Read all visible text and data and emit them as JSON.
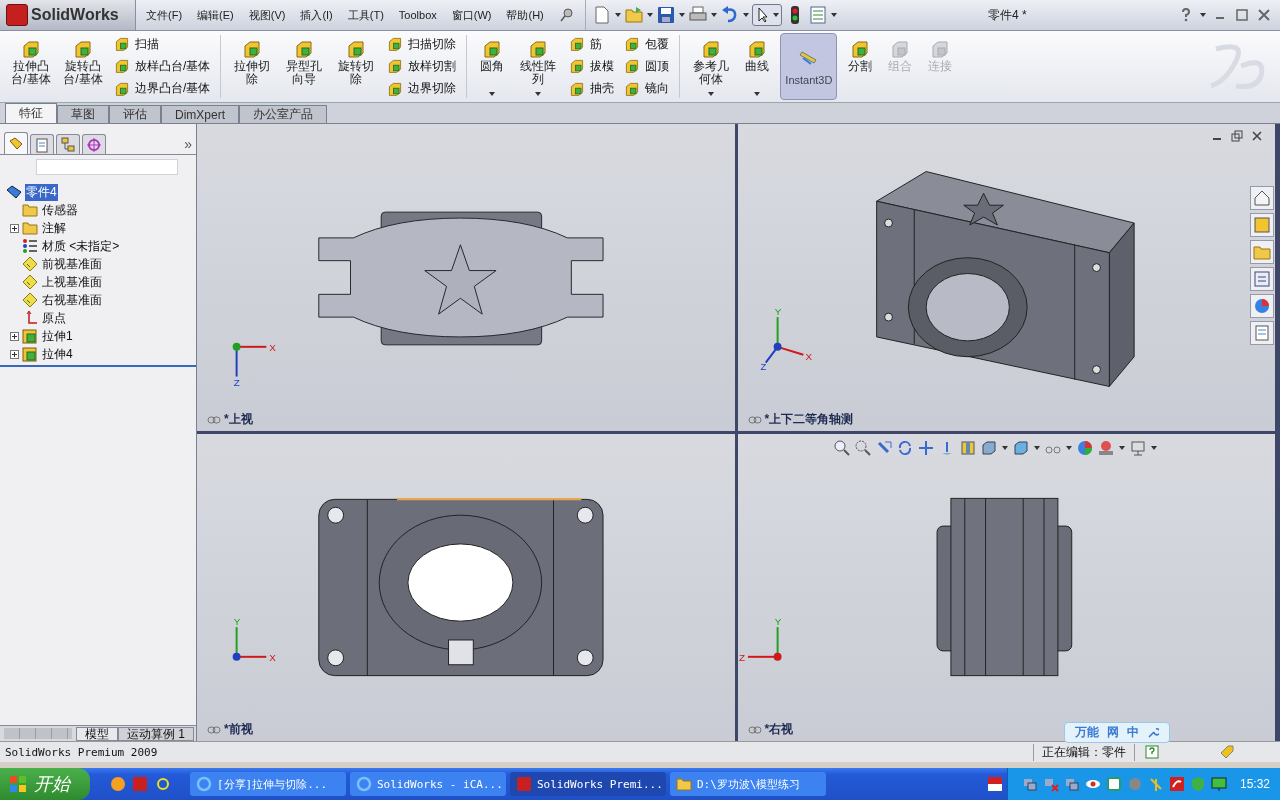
{
  "app": {
    "logo": "SolidWorks"
  },
  "menu": [
    {
      "label": "文件(F)"
    },
    {
      "label": "编辑(E)"
    },
    {
      "label": "视图(V)"
    },
    {
      "label": "插入(I)"
    },
    {
      "label": "工具(T)"
    },
    {
      "label": "Toolbox"
    },
    {
      "label": "窗口(W)"
    },
    {
      "label": "帮助(H)"
    }
  ],
  "document_title": "零件4 *",
  "ribbon": [
    {
      "items": [
        {
          "kind": "large",
          "label": "拉伸凸台/基体",
          "dropdown": false,
          "disabled": false
        },
        {
          "kind": "large",
          "label": "旋转凸台/基体",
          "dropdown": false,
          "disabled": false
        },
        {
          "kind": "stack",
          "items": [
            {
              "label": "扫描"
            },
            {
              "label": "放样凸台/基体"
            },
            {
              "label": "边界凸台/基体"
            }
          ]
        }
      ]
    },
    {
      "items": [
        {
          "kind": "large",
          "label": "拉伸切除",
          "dropdown": false,
          "disabled": false
        },
        {
          "kind": "large",
          "label": "异型孔向导",
          "dropdown": false,
          "disabled": false
        },
        {
          "kind": "large",
          "label": "旋转切除",
          "dropdown": false,
          "disabled": false
        },
        {
          "kind": "stack",
          "items": [
            {
              "label": "扫描切除"
            },
            {
              "label": "放样切割"
            },
            {
              "label": "边界切除"
            }
          ]
        }
      ]
    },
    {
      "items": [
        {
          "kind": "large",
          "label": "圆角",
          "dropdown": true,
          "disabled": false
        },
        {
          "kind": "large",
          "label": "线性阵列",
          "dropdown": true,
          "disabled": false
        },
        {
          "kind": "stack",
          "items": [
            {
              "label": "筋"
            },
            {
              "label": "拔模"
            },
            {
              "label": "抽壳"
            }
          ]
        },
        {
          "kind": "stack",
          "items": [
            {
              "label": "包覆"
            },
            {
              "label": "圆顶"
            },
            {
              "label": "镜向"
            }
          ]
        }
      ]
    },
    {
      "items": [
        {
          "kind": "large",
          "label": "参考几何体",
          "dropdown": true,
          "disabled": false
        },
        {
          "kind": "large",
          "label": "曲线",
          "dropdown": true,
          "disabled": false
        }
      ]
    },
    {
      "items": [
        {
          "kind": "toggle",
          "label": "Instant3D",
          "selected": true
        },
        {
          "kind": "large",
          "label": "分割",
          "dropdown": false,
          "disabled": false
        },
        {
          "kind": "large",
          "label": "组合",
          "dropdown": false,
          "disabled": true
        },
        {
          "kind": "large",
          "label": "连接",
          "dropdown": false,
          "disabled": true
        }
      ]
    }
  ],
  "command_tabs": [
    {
      "label": "特征",
      "selected": true
    },
    {
      "label": "草图",
      "selected": false
    },
    {
      "label": "评估",
      "selected": false
    },
    {
      "label": "DimXpert",
      "selected": false
    },
    {
      "label": "办公室产品",
      "selected": false
    }
  ],
  "feature_tree": {
    "expand": "»",
    "panel_tabs": [
      {
        "kind": "feature",
        "selected": true
      },
      {
        "kind": "property",
        "selected": false
      },
      {
        "kind": "config",
        "selected": false
      },
      {
        "kind": "display",
        "selected": false
      }
    ],
    "root": {
      "label": "零件4",
      "selected": true,
      "children": [
        {
          "label": "传感器",
          "kind": "folder",
          "collapsed": false
        },
        {
          "label": "注解",
          "kind": "folder",
          "collapsed": true
        },
        {
          "label": "材质 <未指定>",
          "kind": "material",
          "collapsed": false
        },
        {
          "label": "前视基准面",
          "kind": "plane",
          "collapsed": false
        },
        {
          "label": "上视基准面",
          "kind": "plane",
          "collapsed": false
        },
        {
          "label": "右视基准面",
          "kind": "plane",
          "collapsed": false
        },
        {
          "label": "原点",
          "kind": "origin",
          "collapsed": false
        },
        {
          "label": "拉伸1",
          "kind": "feature",
          "collapsed": true
        },
        {
          "label": "拉伸4",
          "kind": "feature",
          "collapsed": true
        }
      ]
    }
  },
  "viewports": [
    {
      "label": "*上视",
      "kind": "top",
      "axes": [
        {
          "label": "X",
          "kind": "right"
        },
        {
          "label": "Z",
          "kind": "down"
        }
      ]
    },
    {
      "label": "*上下二等角轴测",
      "kind": "isometric",
      "axes": [
        {
          "label": "Y",
          "kind": "up"
        },
        {
          "label": "X",
          "kind": "down-right"
        },
        {
          "label": "Z",
          "kind": "down-left"
        }
      ]
    },
    {
      "label": "*前视",
      "kind": "front",
      "axes": [
        {
          "label": "Y",
          "kind": "up"
        },
        {
          "label": "X",
          "kind": "right"
        }
      ]
    },
    {
      "label": "*右视",
      "kind": "right",
      "axes": [
        {
          "label": "Y",
          "kind": "up"
        },
        {
          "label": "Z",
          "kind": "left"
        }
      ]
    }
  ],
  "bottom_tabs": [
    {
      "label": "模型",
      "selected": true
    },
    {
      "label": "运动算例 1",
      "selected": false
    }
  ],
  "ime_bar": {
    "items": [
      "万能",
      "网",
      "中"
    ]
  },
  "status_bar": {
    "product": "SolidWorks Premium 2009",
    "editing": "正在编辑：零件"
  },
  "taskbar": {
    "start": "开始",
    "tasks": [
      {
        "label": "[分享]拉伸与切除...",
        "kind": "browser",
        "selected": false
      },
      {
        "label": "SolidWorks - iCA...",
        "kind": "browser",
        "selected": false
      },
      {
        "label": "SolidWorks Premi...",
        "kind": "solidworks",
        "selected": true
      },
      {
        "label": "D:\\罗功波\\模型练习",
        "kind": "folder",
        "selected": false
      }
    ],
    "clock": "15:32"
  }
}
